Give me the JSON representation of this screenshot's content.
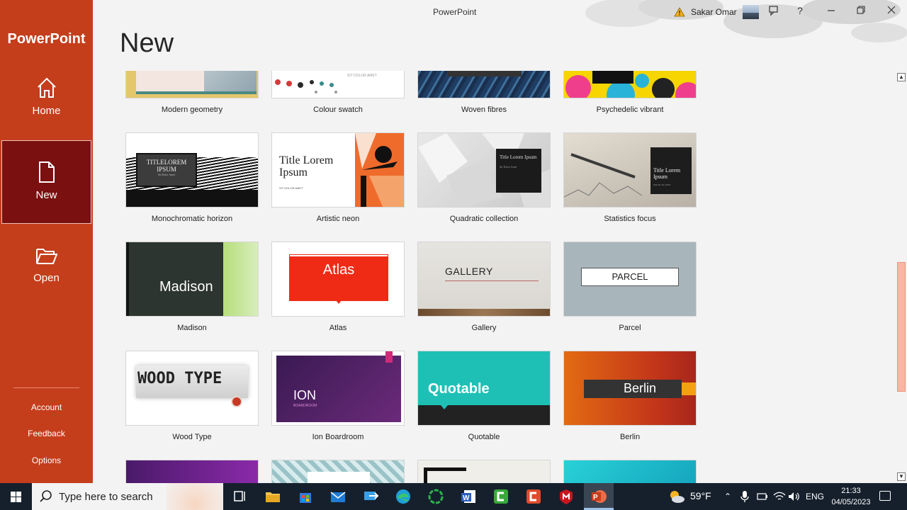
{
  "app": {
    "brand": "PowerPoint",
    "window_title": "PowerPoint"
  },
  "sidebar": {
    "nav": [
      {
        "label": "Home",
        "icon": "home-icon"
      },
      {
        "label": "New",
        "icon": "new-document-icon",
        "selected": true
      },
      {
        "label": "Open",
        "icon": "open-folder-icon"
      }
    ],
    "links": [
      "Account",
      "Feedback",
      "Options"
    ]
  },
  "titlebar": {
    "user_name": "Sakar Omar",
    "buttons": [
      "warning-icon",
      "feedback-icon",
      "help-icon",
      "minimize-icon",
      "restore-icon",
      "close-icon"
    ]
  },
  "page": {
    "title": "New"
  },
  "templates": [
    {
      "name": "Modern geometry"
    },
    {
      "name": "Colour swatch",
      "thumb_text": "SIT DOLOR AMET"
    },
    {
      "name": "Woven fibres"
    },
    {
      "name": "Psychedelic vibrant"
    },
    {
      "name": "Monochromatic horizon",
      "thumb_text": "TITLELOREM IPSUM",
      "thumb_sub": "Sit Dolor Amet"
    },
    {
      "name": "Artistic neon",
      "thumb_text": "Title Lorem Ipsum",
      "thumb_sub": "SIT DOLOR AMET"
    },
    {
      "name": "Quadratic collection",
      "thumb_text": "Title Lorem Ipsum",
      "thumb_sub": "Sit Dolor Amet"
    },
    {
      "name": "Statistics focus",
      "thumb_text": "Title Lorem Ipsum",
      "thumb_sub": "DOLOR SIT AMET"
    },
    {
      "name": "Madison",
      "thumb_text": "Madison"
    },
    {
      "name": "Atlas",
      "thumb_text": "Atlas"
    },
    {
      "name": "Gallery",
      "thumb_text": "GALLERY"
    },
    {
      "name": "Parcel",
      "thumb_text": "PARCEL"
    },
    {
      "name": "Wood Type",
      "thumb_text": "WOOD TYPE"
    },
    {
      "name": "Ion Boardroom",
      "thumb_text": "ION",
      "thumb_sub": "BOARDROOM"
    },
    {
      "name": "Quotable",
      "thumb_text": "Quotable"
    },
    {
      "name": "Berlin",
      "thumb_text": "Berlin"
    }
  ],
  "taskbar": {
    "search_placeholder": "Type here to search",
    "weather": "59°F",
    "language": "ENG",
    "time": "21:33",
    "date": "04/05/2023",
    "apps": [
      "task-view-icon",
      "file-explorer-icon",
      "store-icon",
      "mail-icon",
      "remote-icon",
      "edge-icon",
      "circle-app-icon",
      "word-icon",
      "green-app-icon",
      "red-app-icon",
      "mcafee-icon",
      "powerpoint-icon"
    ]
  },
  "colors": {
    "accent": "#c43e1c",
    "selected_nav": "#7a1010",
    "taskbar": "#16202d"
  }
}
